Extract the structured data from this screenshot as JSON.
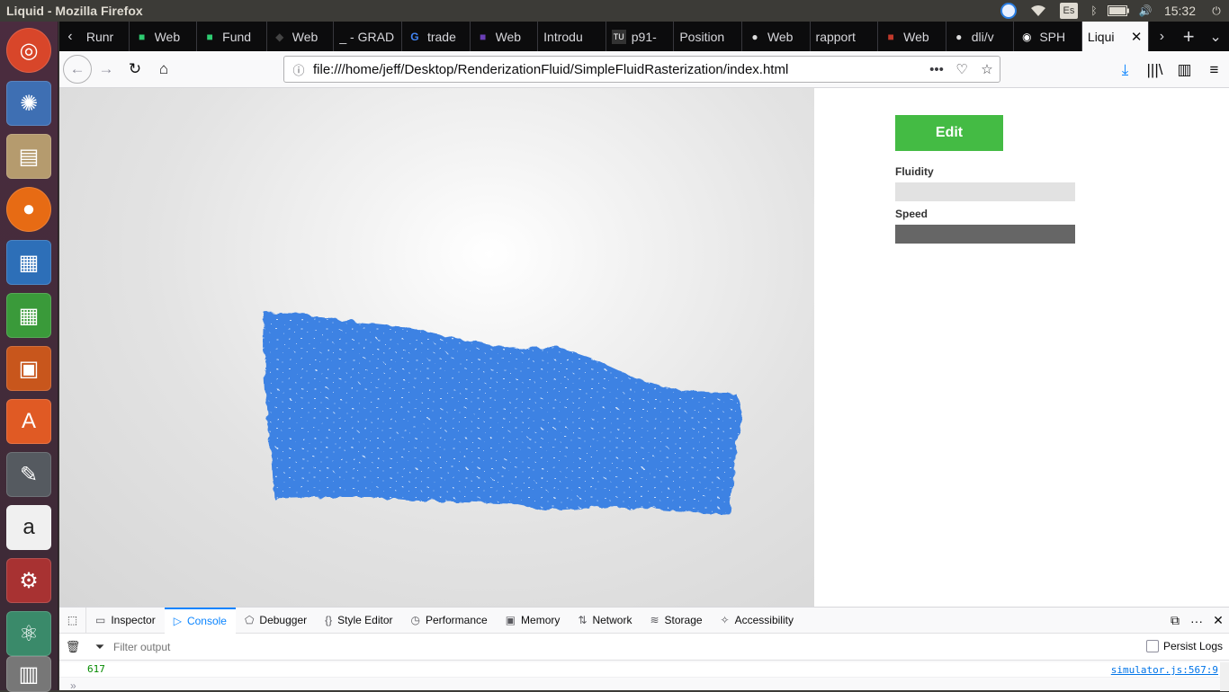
{
  "window": {
    "title": "Liquid - Mozilla Firefox"
  },
  "tray": {
    "keyboard": "Es",
    "clock": "15:32"
  },
  "launcher": [
    {
      "name": "ubuntu-dash",
      "color": "#d8462a"
    },
    {
      "name": "app-swirl",
      "color": "#3e6fb3"
    },
    {
      "name": "files",
      "color": "#b59b6e"
    },
    {
      "name": "firefox",
      "color": "#e76b14"
    },
    {
      "name": "libreoffice-writer",
      "color": "#2d6fb8"
    },
    {
      "name": "libreoffice-calc",
      "color": "#3a9a3a"
    },
    {
      "name": "libreoffice-impress",
      "color": "#c8561c"
    },
    {
      "name": "ubuntu-software",
      "color": "#e05a24"
    },
    {
      "name": "text-editor",
      "color": "#555a60"
    },
    {
      "name": "amazon",
      "color": "#f0f0f0"
    },
    {
      "name": "system-settings",
      "color": "#a83232"
    },
    {
      "name": "atom",
      "color": "#3a8a6a"
    }
  ],
  "tabs": [
    {
      "label": "Runr",
      "fav": "",
      "favcolor": "#888"
    },
    {
      "label": "Web",
      "fav": "■",
      "favcolor": "#2ecc71"
    },
    {
      "label": "Fund",
      "fav": "■",
      "favcolor": "#2ecc71"
    },
    {
      "label": "Web",
      "fav": "◆",
      "favcolor": "#444"
    },
    {
      "label": "_ - GRAD",
      "fav": "",
      "favcolor": "#888"
    },
    {
      "label": "trade",
      "fav": "G",
      "favcolor": "#4285f4"
    },
    {
      "label": "Web",
      "fav": "■",
      "favcolor": "#6a3fb5"
    },
    {
      "label": "Introdu",
      "fav": "",
      "favcolor": "#888"
    },
    {
      "label": "p91-",
      "fav": "TU",
      "favcolor": "#fff"
    },
    {
      "label": "Position",
      "fav": "",
      "favcolor": "#888"
    },
    {
      "label": "Web",
      "fav": "●",
      "favcolor": "#ddd"
    },
    {
      "label": "rapport",
      "fav": "",
      "favcolor": "#888"
    },
    {
      "label": "Web",
      "fav": "■",
      "favcolor": "#c0392b"
    },
    {
      "label": "dli/v",
      "fav": "●",
      "favcolor": "#ddd"
    },
    {
      "label": "SPH",
      "fav": "◉",
      "favcolor": "#fff"
    },
    {
      "label": "Liqui",
      "fav": "",
      "favcolor": "#888"
    }
  ],
  "urlbar": {
    "url": "file:///home/jeff/Desktop/RenderizationFluid/SimpleFluidRasterization/index.html"
  },
  "panel": {
    "edit_label": "Edit",
    "fluidity_label": "Fluidity",
    "fluidity_value": 0,
    "speed_label": "Speed",
    "speed_value": 1
  },
  "colors": {
    "fluid": "#3d82e3",
    "edit_button": "#44bb44",
    "slider_track": "#e2e2e2",
    "slider_fill": "#666666"
  },
  "devtools": {
    "tabs": [
      "Inspector",
      "Console",
      "Debugger",
      "Style Editor",
      "Performance",
      "Memory",
      "Network",
      "Storage",
      "Accessibility"
    ],
    "active_tab": "Console",
    "filter_placeholder": "Filter output",
    "persist_label": "Persist Logs",
    "console": [
      {
        "value": "617",
        "source": "simulator.js:567:9"
      }
    ]
  }
}
